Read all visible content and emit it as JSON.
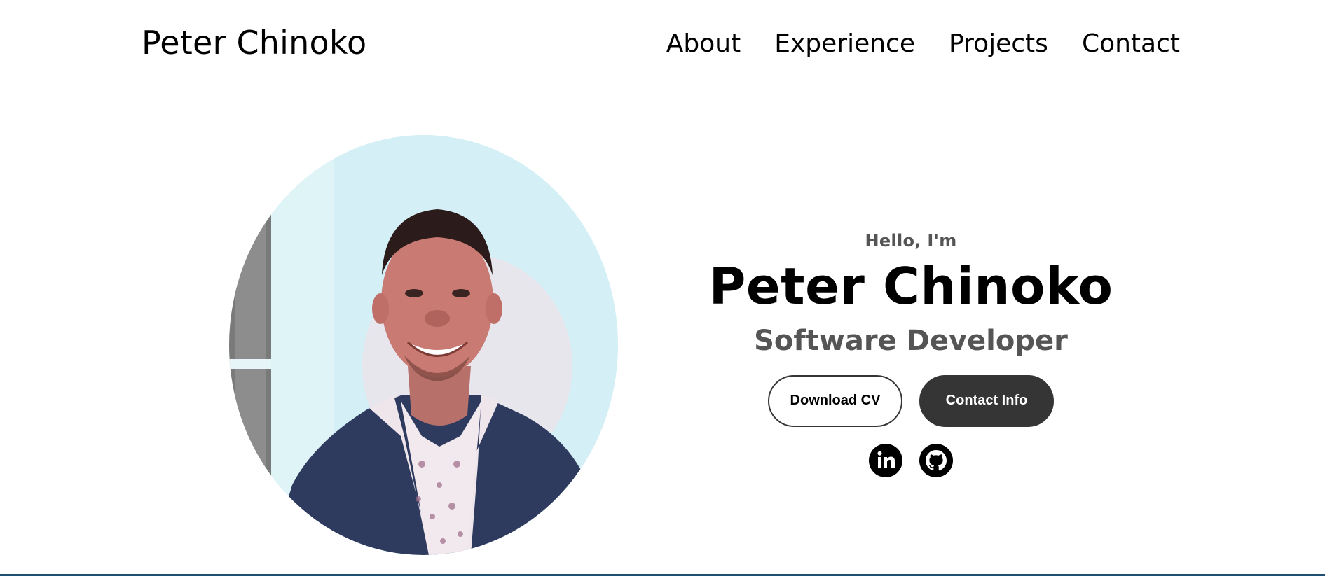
{
  "header": {
    "brand": "Peter Chinoko",
    "nav": [
      "About",
      "Experience",
      "Projects",
      "Contact"
    ]
  },
  "hero": {
    "greeting": "Hello, I'm",
    "name": "Peter Chinoko",
    "role": "Software Developer",
    "buttons": {
      "download_cv": "Download CV",
      "contact_info": "Contact Info"
    },
    "socials": [
      "linkedin-icon",
      "github-icon"
    ],
    "photo_alt": "Portrait photo"
  },
  "colors": {
    "primary_text": "#000000",
    "secondary_text": "#555555",
    "button_dark": "#353535",
    "bottom_rule": "#1f4f72"
  }
}
